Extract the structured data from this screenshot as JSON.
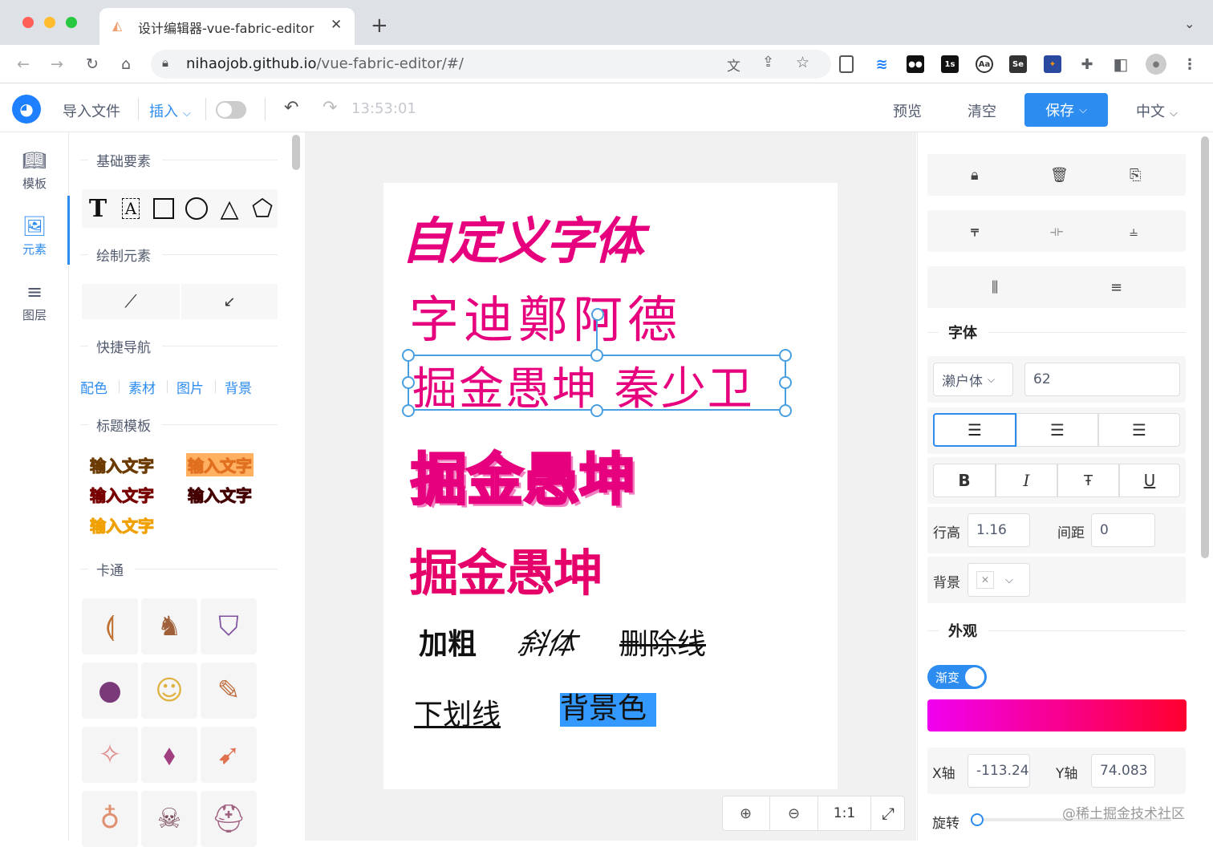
{
  "browser": {
    "tab_title": "设计编辑器-vue-fabric-editor",
    "url_host": "nihaojob.github.io",
    "url_path": "/vue-fabric-editor/#/"
  },
  "header": {
    "import_label": "导入文件",
    "insert_label": "插入",
    "timestamp": "13:53:01",
    "preview_label": "预览",
    "clear_label": "清空",
    "save_label": "保存",
    "language_label": "中文"
  },
  "leftnav": {
    "items": [
      {
        "label": "模板",
        "icon": "book-icon"
      },
      {
        "label": "元素",
        "icon": "image-icon"
      },
      {
        "label": "图层",
        "icon": "layers-icon"
      }
    ]
  },
  "panel": {
    "basic_title": "基础要素",
    "draw_title": "绘制元素",
    "nav_title": "快捷导航",
    "nav_links": [
      "配色",
      "素材",
      "图片",
      "背景"
    ],
    "title_tpl_title": "标题模板",
    "title_tpl_text": [
      "输入文字",
      "输入文字",
      "输入文字",
      "输入文字",
      "输入文字"
    ],
    "cartoon_title": "卡通"
  },
  "canvas": {
    "text1": "自定义字体",
    "text2": "字迪鄭阿德",
    "text3": "掘金愚坤 秦少卫",
    "text4": "掘金愚坤",
    "text5": "掘金愚坤",
    "bold_label": "加粗",
    "italic_label": "斜体",
    "strike_label": "删除线",
    "underline_label": "下划线",
    "bg_label": "背景色",
    "zoom_reset": "1:1"
  },
  "props": {
    "font_title": "字体",
    "font_family": "濑户体",
    "font_size": "62",
    "line_height_label": "行高",
    "line_height": "1.16",
    "spacing_label": "间距",
    "spacing": "0",
    "bg_label": "背景",
    "appearance_title": "外观",
    "gradient_label": "渐变",
    "gradient_start": "#f000f0",
    "gradient_end": "#ff0030",
    "x_label": "X轴",
    "x_value": "-113.24",
    "y_label": "Y轴",
    "y_value": "74.083",
    "rotate_label": "旋转",
    "bold_btn": "B",
    "italic_btn": "I",
    "underline_btn": "U"
  },
  "watermark": "@稀土掘金技术社区",
  "colors": {
    "accent": "#2d8cf0",
    "magenta": "#e6007e"
  }
}
